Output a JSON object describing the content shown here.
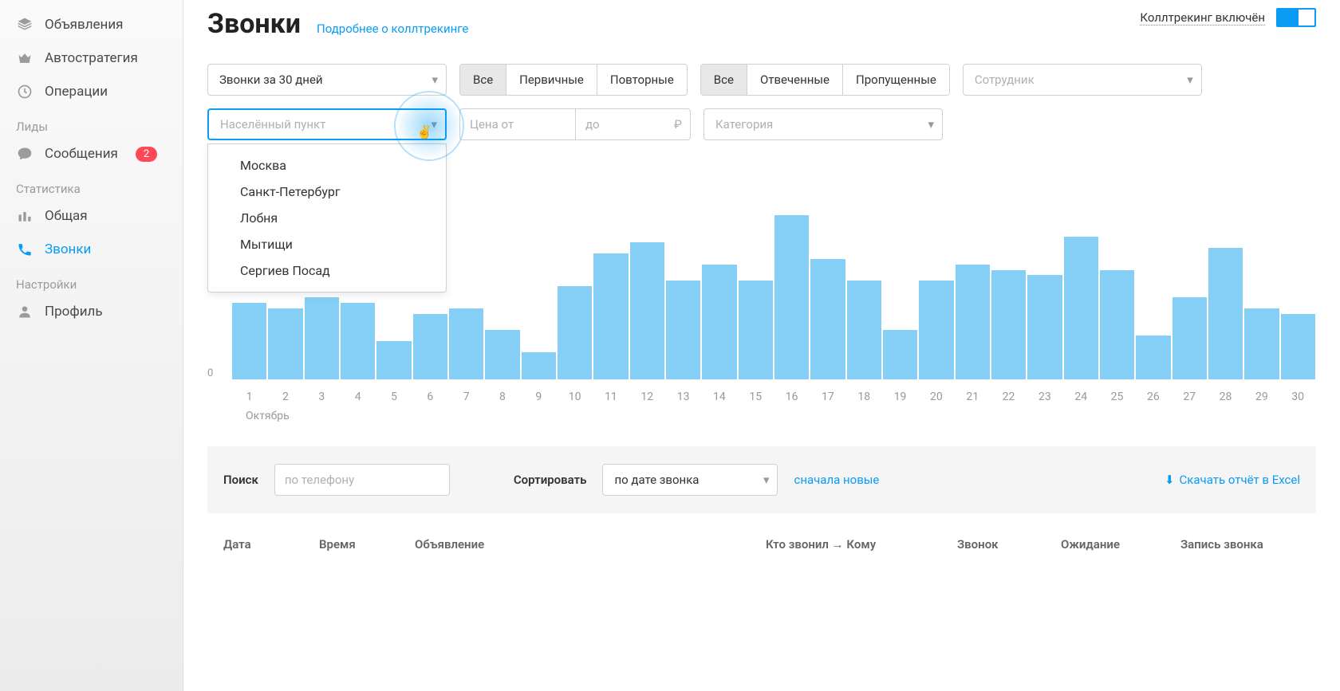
{
  "sidebar": {
    "items": [
      {
        "label": "Объявления",
        "icon": "layers"
      },
      {
        "label": "Автостратегия",
        "icon": "crown"
      },
      {
        "label": "Операции",
        "icon": "history"
      }
    ],
    "section_leads": "Лиды",
    "messages": {
      "label": "Сообщения",
      "badge": "2"
    },
    "section_stats": "Статистика",
    "stats_items": [
      {
        "label": "Общая",
        "icon": "bars"
      },
      {
        "label": "Звонки",
        "icon": "phone",
        "active": true
      }
    ],
    "section_settings": "Настройки",
    "profile": {
      "label": "Профиль"
    }
  },
  "header": {
    "title": "Звонки",
    "more_link": "Подробнее о коллтрекинге",
    "ct_label": "Коллтрекинг включён"
  },
  "filters": {
    "period": "Звонки за 30 дней",
    "type": {
      "all": "Все",
      "primary": "Первичные",
      "repeat": "Повторные"
    },
    "status": {
      "all": "Все",
      "answered": "Отвеченные",
      "missed": "Пропущенные"
    },
    "employee_placeholder": "Сотрудник",
    "city_placeholder": "Населённый пункт",
    "city_options": [
      "Москва",
      "Санкт-Петербург",
      "Лобня",
      "Мытищи",
      "Сергиев Посад"
    ],
    "price_from_placeholder": "Цена от",
    "price_to_placeholder": "до",
    "category_placeholder": "Категория"
  },
  "chart_data": {
    "type": "bar",
    "title": "",
    "xlabel": "Октябрь",
    "ylabel": "",
    "ylim": [
      0,
      32
    ],
    "categories": [
      "1",
      "2",
      "3",
      "4",
      "5",
      "6",
      "7",
      "8",
      "9",
      "10",
      "11",
      "12",
      "13",
      "14",
      "15",
      "16",
      "17",
      "18",
      "19",
      "20",
      "21",
      "22",
      "23",
      "24",
      "25",
      "26",
      "27",
      "28",
      "29",
      "30"
    ],
    "values": [
      14,
      13,
      15,
      14,
      7,
      12,
      13,
      9,
      5,
      17,
      23,
      25,
      18,
      21,
      18,
      30,
      22,
      18,
      9,
      18,
      21,
      20,
      19,
      26,
      20,
      8,
      15,
      24,
      13,
      12
    ],
    "axis_zero": "0"
  },
  "search_sort": {
    "search_label": "Поиск",
    "search_placeholder": "по телефону",
    "sort_label": "Сортировать",
    "sort_value": "по дате звонка",
    "sort_dir": "сначала новые",
    "download": "Скачать отчёт в Excel"
  },
  "table": {
    "col_date": "Дата",
    "col_time": "Время",
    "col_ad": "Объявление",
    "col_who": "Кто звонил → Кому",
    "col_call": "Звонок",
    "col_wait": "Ожидание",
    "col_record": "Запись звонка"
  }
}
